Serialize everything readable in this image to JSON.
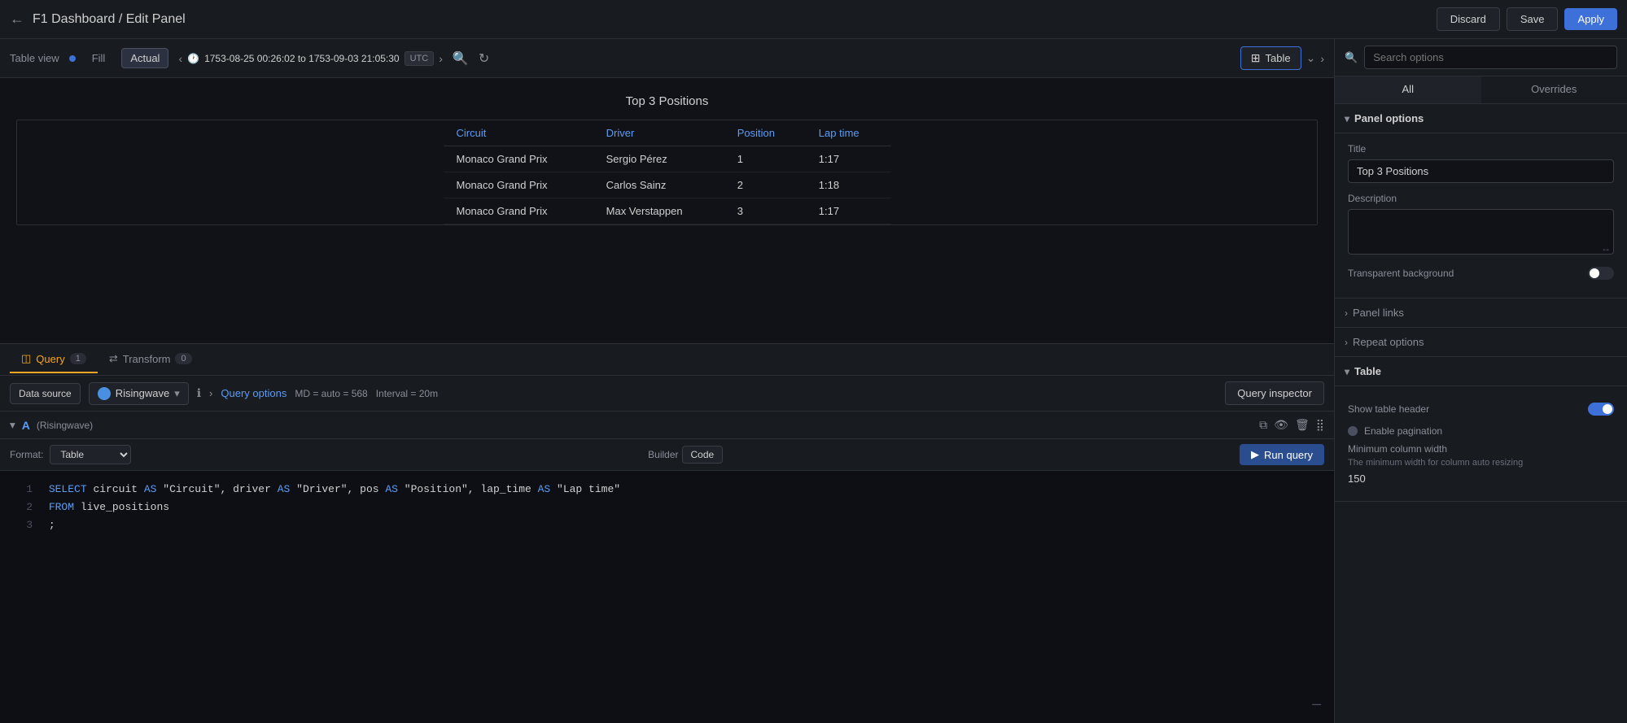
{
  "topbar": {
    "back_icon": "←",
    "title": "F1 Dashboard / Edit Panel",
    "discard_label": "Discard",
    "save_label": "Save",
    "apply_label": "Apply"
  },
  "viztoolbar": {
    "table_view_label": "Table view",
    "fill_label": "Fill",
    "actual_label": "Actual",
    "time_range": "1753-08-25 00:26:02 to 1753-09-03 21:05:30",
    "utc_label": "UTC",
    "viz_type_label": "Table",
    "prev_icon": "‹",
    "next_icon": "›"
  },
  "panel": {
    "title": "Top 3 Positions",
    "columns": [
      "Circuit",
      "Driver",
      "Position",
      "Lap time"
    ],
    "rows": [
      [
        "Monaco Grand Prix",
        "Sergio Pérez",
        "1",
        "1:17"
      ],
      [
        "Monaco Grand Prix",
        "Carlos Sainz",
        "2",
        "1:18"
      ],
      [
        "Monaco Grand Prix",
        "Max Verstappen",
        "3",
        "1:17"
      ]
    ]
  },
  "bottom_tabs": {
    "query_label": "Query",
    "query_count": "1",
    "transform_label": "Transform",
    "transform_count": "0"
  },
  "query_bar": {
    "data_source_label": "Data source",
    "risingwave_label": "Risingwave",
    "arrow_icon": "›",
    "query_options_label": "Query options",
    "md_label": "MD = auto = 568",
    "interval_label": "Interval = 20m",
    "query_inspector_label": "Query inspector"
  },
  "editor": {
    "letter": "A",
    "source": "(Risingwave)",
    "copy_icon": "⧉",
    "eye_icon": "👁",
    "trash_icon": "🗑",
    "drag_icon": "⣿",
    "format_label": "Format:",
    "format_value": "Table",
    "run_label": "Run query",
    "builder_label": "Builder",
    "code_label": "Code",
    "lines": [
      {
        "num": "1",
        "content": "SELECT circuit AS \"Circuit\", driver AS \"Driver\", pos AS \"Position\", lap_time AS \"Lap time\""
      },
      {
        "num": "2",
        "content": "FROM live_positions"
      },
      {
        "num": "3",
        "content": ";"
      }
    ]
  },
  "right_panel": {
    "search_placeholder": "Search options",
    "all_tab": "All",
    "overrides_tab": "Overrides",
    "panel_options_label": "Panel options",
    "title_label": "Title",
    "title_value": "Top 3 Positions",
    "description_label": "Description",
    "description_value": "",
    "transparent_bg_label": "Transparent background",
    "panel_links_label": "Panel links",
    "repeat_options_label": "Repeat options",
    "table_section_label": "Table",
    "show_header_label": "Show table header",
    "enable_pagination_label": "Enable pagination",
    "min_col_width_label": "Minimum column width",
    "min_col_width_desc": "The minimum width for column auto resizing",
    "min_col_width_value": "150"
  }
}
